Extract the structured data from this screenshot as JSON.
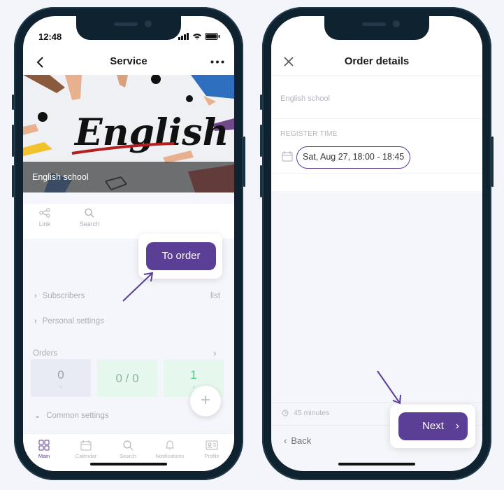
{
  "status": {
    "time": "12:48"
  },
  "left": {
    "nav": {
      "title": "Service"
    },
    "hero": {
      "caption": "English school",
      "art_text": "English"
    },
    "actions": [
      {
        "label": "Link",
        "icon": "share-icon"
      },
      {
        "label": "Search",
        "icon": "search-icon"
      }
    ],
    "to_order": "To order",
    "rows": {
      "subscribers": "Subscribers",
      "subscribers_right": "list",
      "personal": "Personal settings",
      "orders": "Orders",
      "common": "Common settings"
    },
    "tiles": [
      "0",
      "0 / 0",
      "1"
    ],
    "tabs": [
      {
        "label": "Main",
        "icon": "grid-icon"
      },
      {
        "label": "Calendar",
        "icon": "calendar-icon"
      },
      {
        "label": "Search",
        "icon": "search-icon"
      },
      {
        "label": "Notifications",
        "icon": "bell-icon"
      },
      {
        "label": "Profile",
        "icon": "profile-icon"
      }
    ]
  },
  "right": {
    "nav": {
      "title": "Order details"
    },
    "school": "English school",
    "register_label": "REGISTER TIME",
    "register_value": "Sat, Aug 27, 18:00 - 18:45",
    "duration": "45 minutes",
    "back": "Back",
    "next": "Next"
  },
  "colors": {
    "accent": "#5b3f96",
    "tile_blue": "#e8ebf3",
    "tile_green": "#e6f7ee",
    "green_text": "#3ccf7a"
  }
}
